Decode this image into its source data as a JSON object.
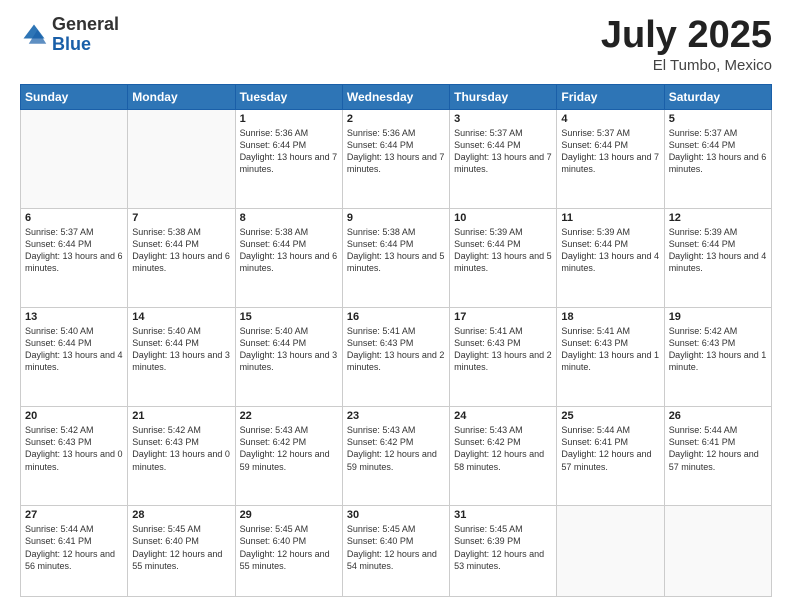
{
  "logo": {
    "general": "General",
    "blue": "Blue"
  },
  "header": {
    "month": "July 2025",
    "location": "El Tumbo, Mexico"
  },
  "weekdays": [
    "Sunday",
    "Monday",
    "Tuesday",
    "Wednesday",
    "Thursday",
    "Friday",
    "Saturday"
  ],
  "weeks": [
    [
      {
        "day": "",
        "info": ""
      },
      {
        "day": "",
        "info": ""
      },
      {
        "day": "1",
        "info": "Sunrise: 5:36 AM\nSunset: 6:44 PM\nDaylight: 13 hours and 7 minutes."
      },
      {
        "day": "2",
        "info": "Sunrise: 5:36 AM\nSunset: 6:44 PM\nDaylight: 13 hours and 7 minutes."
      },
      {
        "day": "3",
        "info": "Sunrise: 5:37 AM\nSunset: 6:44 PM\nDaylight: 13 hours and 7 minutes."
      },
      {
        "day": "4",
        "info": "Sunrise: 5:37 AM\nSunset: 6:44 PM\nDaylight: 13 hours and 7 minutes."
      },
      {
        "day": "5",
        "info": "Sunrise: 5:37 AM\nSunset: 6:44 PM\nDaylight: 13 hours and 6 minutes."
      }
    ],
    [
      {
        "day": "6",
        "info": "Sunrise: 5:37 AM\nSunset: 6:44 PM\nDaylight: 13 hours and 6 minutes."
      },
      {
        "day": "7",
        "info": "Sunrise: 5:38 AM\nSunset: 6:44 PM\nDaylight: 13 hours and 6 minutes."
      },
      {
        "day": "8",
        "info": "Sunrise: 5:38 AM\nSunset: 6:44 PM\nDaylight: 13 hours and 6 minutes."
      },
      {
        "day": "9",
        "info": "Sunrise: 5:38 AM\nSunset: 6:44 PM\nDaylight: 13 hours and 5 minutes."
      },
      {
        "day": "10",
        "info": "Sunrise: 5:39 AM\nSunset: 6:44 PM\nDaylight: 13 hours and 5 minutes."
      },
      {
        "day": "11",
        "info": "Sunrise: 5:39 AM\nSunset: 6:44 PM\nDaylight: 13 hours and 4 minutes."
      },
      {
        "day": "12",
        "info": "Sunrise: 5:39 AM\nSunset: 6:44 PM\nDaylight: 13 hours and 4 minutes."
      }
    ],
    [
      {
        "day": "13",
        "info": "Sunrise: 5:40 AM\nSunset: 6:44 PM\nDaylight: 13 hours and 4 minutes."
      },
      {
        "day": "14",
        "info": "Sunrise: 5:40 AM\nSunset: 6:44 PM\nDaylight: 13 hours and 3 minutes."
      },
      {
        "day": "15",
        "info": "Sunrise: 5:40 AM\nSunset: 6:44 PM\nDaylight: 13 hours and 3 minutes."
      },
      {
        "day": "16",
        "info": "Sunrise: 5:41 AM\nSunset: 6:43 PM\nDaylight: 13 hours and 2 minutes."
      },
      {
        "day": "17",
        "info": "Sunrise: 5:41 AM\nSunset: 6:43 PM\nDaylight: 13 hours and 2 minutes."
      },
      {
        "day": "18",
        "info": "Sunrise: 5:41 AM\nSunset: 6:43 PM\nDaylight: 13 hours and 1 minute."
      },
      {
        "day": "19",
        "info": "Sunrise: 5:42 AM\nSunset: 6:43 PM\nDaylight: 13 hours and 1 minute."
      }
    ],
    [
      {
        "day": "20",
        "info": "Sunrise: 5:42 AM\nSunset: 6:43 PM\nDaylight: 13 hours and 0 minutes."
      },
      {
        "day": "21",
        "info": "Sunrise: 5:42 AM\nSunset: 6:43 PM\nDaylight: 13 hours and 0 minutes."
      },
      {
        "day": "22",
        "info": "Sunrise: 5:43 AM\nSunset: 6:42 PM\nDaylight: 12 hours and 59 minutes."
      },
      {
        "day": "23",
        "info": "Sunrise: 5:43 AM\nSunset: 6:42 PM\nDaylight: 12 hours and 59 minutes."
      },
      {
        "day": "24",
        "info": "Sunrise: 5:43 AM\nSunset: 6:42 PM\nDaylight: 12 hours and 58 minutes."
      },
      {
        "day": "25",
        "info": "Sunrise: 5:44 AM\nSunset: 6:41 PM\nDaylight: 12 hours and 57 minutes."
      },
      {
        "day": "26",
        "info": "Sunrise: 5:44 AM\nSunset: 6:41 PM\nDaylight: 12 hours and 57 minutes."
      }
    ],
    [
      {
        "day": "27",
        "info": "Sunrise: 5:44 AM\nSunset: 6:41 PM\nDaylight: 12 hours and 56 minutes."
      },
      {
        "day": "28",
        "info": "Sunrise: 5:45 AM\nSunset: 6:40 PM\nDaylight: 12 hours and 55 minutes."
      },
      {
        "day": "29",
        "info": "Sunrise: 5:45 AM\nSunset: 6:40 PM\nDaylight: 12 hours and 55 minutes."
      },
      {
        "day": "30",
        "info": "Sunrise: 5:45 AM\nSunset: 6:40 PM\nDaylight: 12 hours and 54 minutes."
      },
      {
        "day": "31",
        "info": "Sunrise: 5:45 AM\nSunset: 6:39 PM\nDaylight: 12 hours and 53 minutes."
      },
      {
        "day": "",
        "info": ""
      },
      {
        "day": "",
        "info": ""
      }
    ]
  ]
}
